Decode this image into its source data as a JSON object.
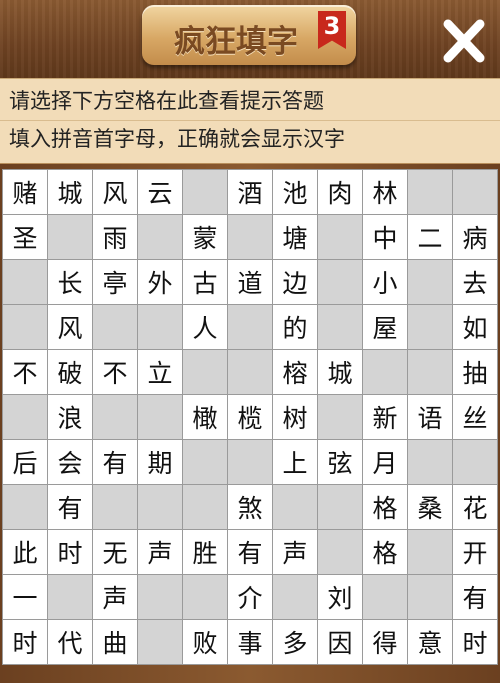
{
  "header": {
    "title": "疯狂填字",
    "level": "3",
    "close_icon": "close-icon"
  },
  "hint": {
    "line1": "请选择下方空格在此查看提示答题",
    "line2": "填入拼音首字母，正确就会显示汉字"
  },
  "grid": {
    "rows": [
      [
        "赌",
        "城",
        "风",
        "云",
        "",
        "酒",
        "池",
        "肉",
        "林",
        "",
        ""
      ],
      [
        "圣",
        "",
        "雨",
        "",
        "蒙",
        "",
        "塘",
        "",
        "中",
        "二",
        "病"
      ],
      [
        "",
        "长",
        "亭",
        "外",
        "古",
        "道",
        "边",
        "",
        "小",
        "",
        "去"
      ],
      [
        "",
        "风",
        "",
        "",
        "人",
        "",
        "的",
        "",
        "屋",
        "",
        "如"
      ],
      [
        "不",
        "破",
        "不",
        "立",
        "",
        "",
        "榕",
        "城",
        "",
        "",
        "抽"
      ],
      [
        "",
        "浪",
        "",
        "",
        "橄",
        "榄",
        "树",
        "",
        "新",
        "语",
        "丝"
      ],
      [
        "后",
        "会",
        "有",
        "期",
        "",
        "",
        "上",
        "弦",
        "月",
        "",
        ""
      ],
      [
        "",
        "有",
        "",
        "",
        "",
        "煞",
        "",
        "",
        "格",
        "桑",
        "花"
      ],
      [
        "此",
        "时",
        "无",
        "声",
        "胜",
        "有",
        "声",
        "",
        "格",
        "",
        "开"
      ],
      [
        "一",
        "",
        "声",
        "",
        "",
        "介",
        "",
        "刘",
        "",
        "",
        "有"
      ],
      [
        "时",
        "代",
        "曲",
        "",
        "败",
        "事",
        "多",
        "因",
        "得",
        "意",
        "时"
      ]
    ]
  }
}
